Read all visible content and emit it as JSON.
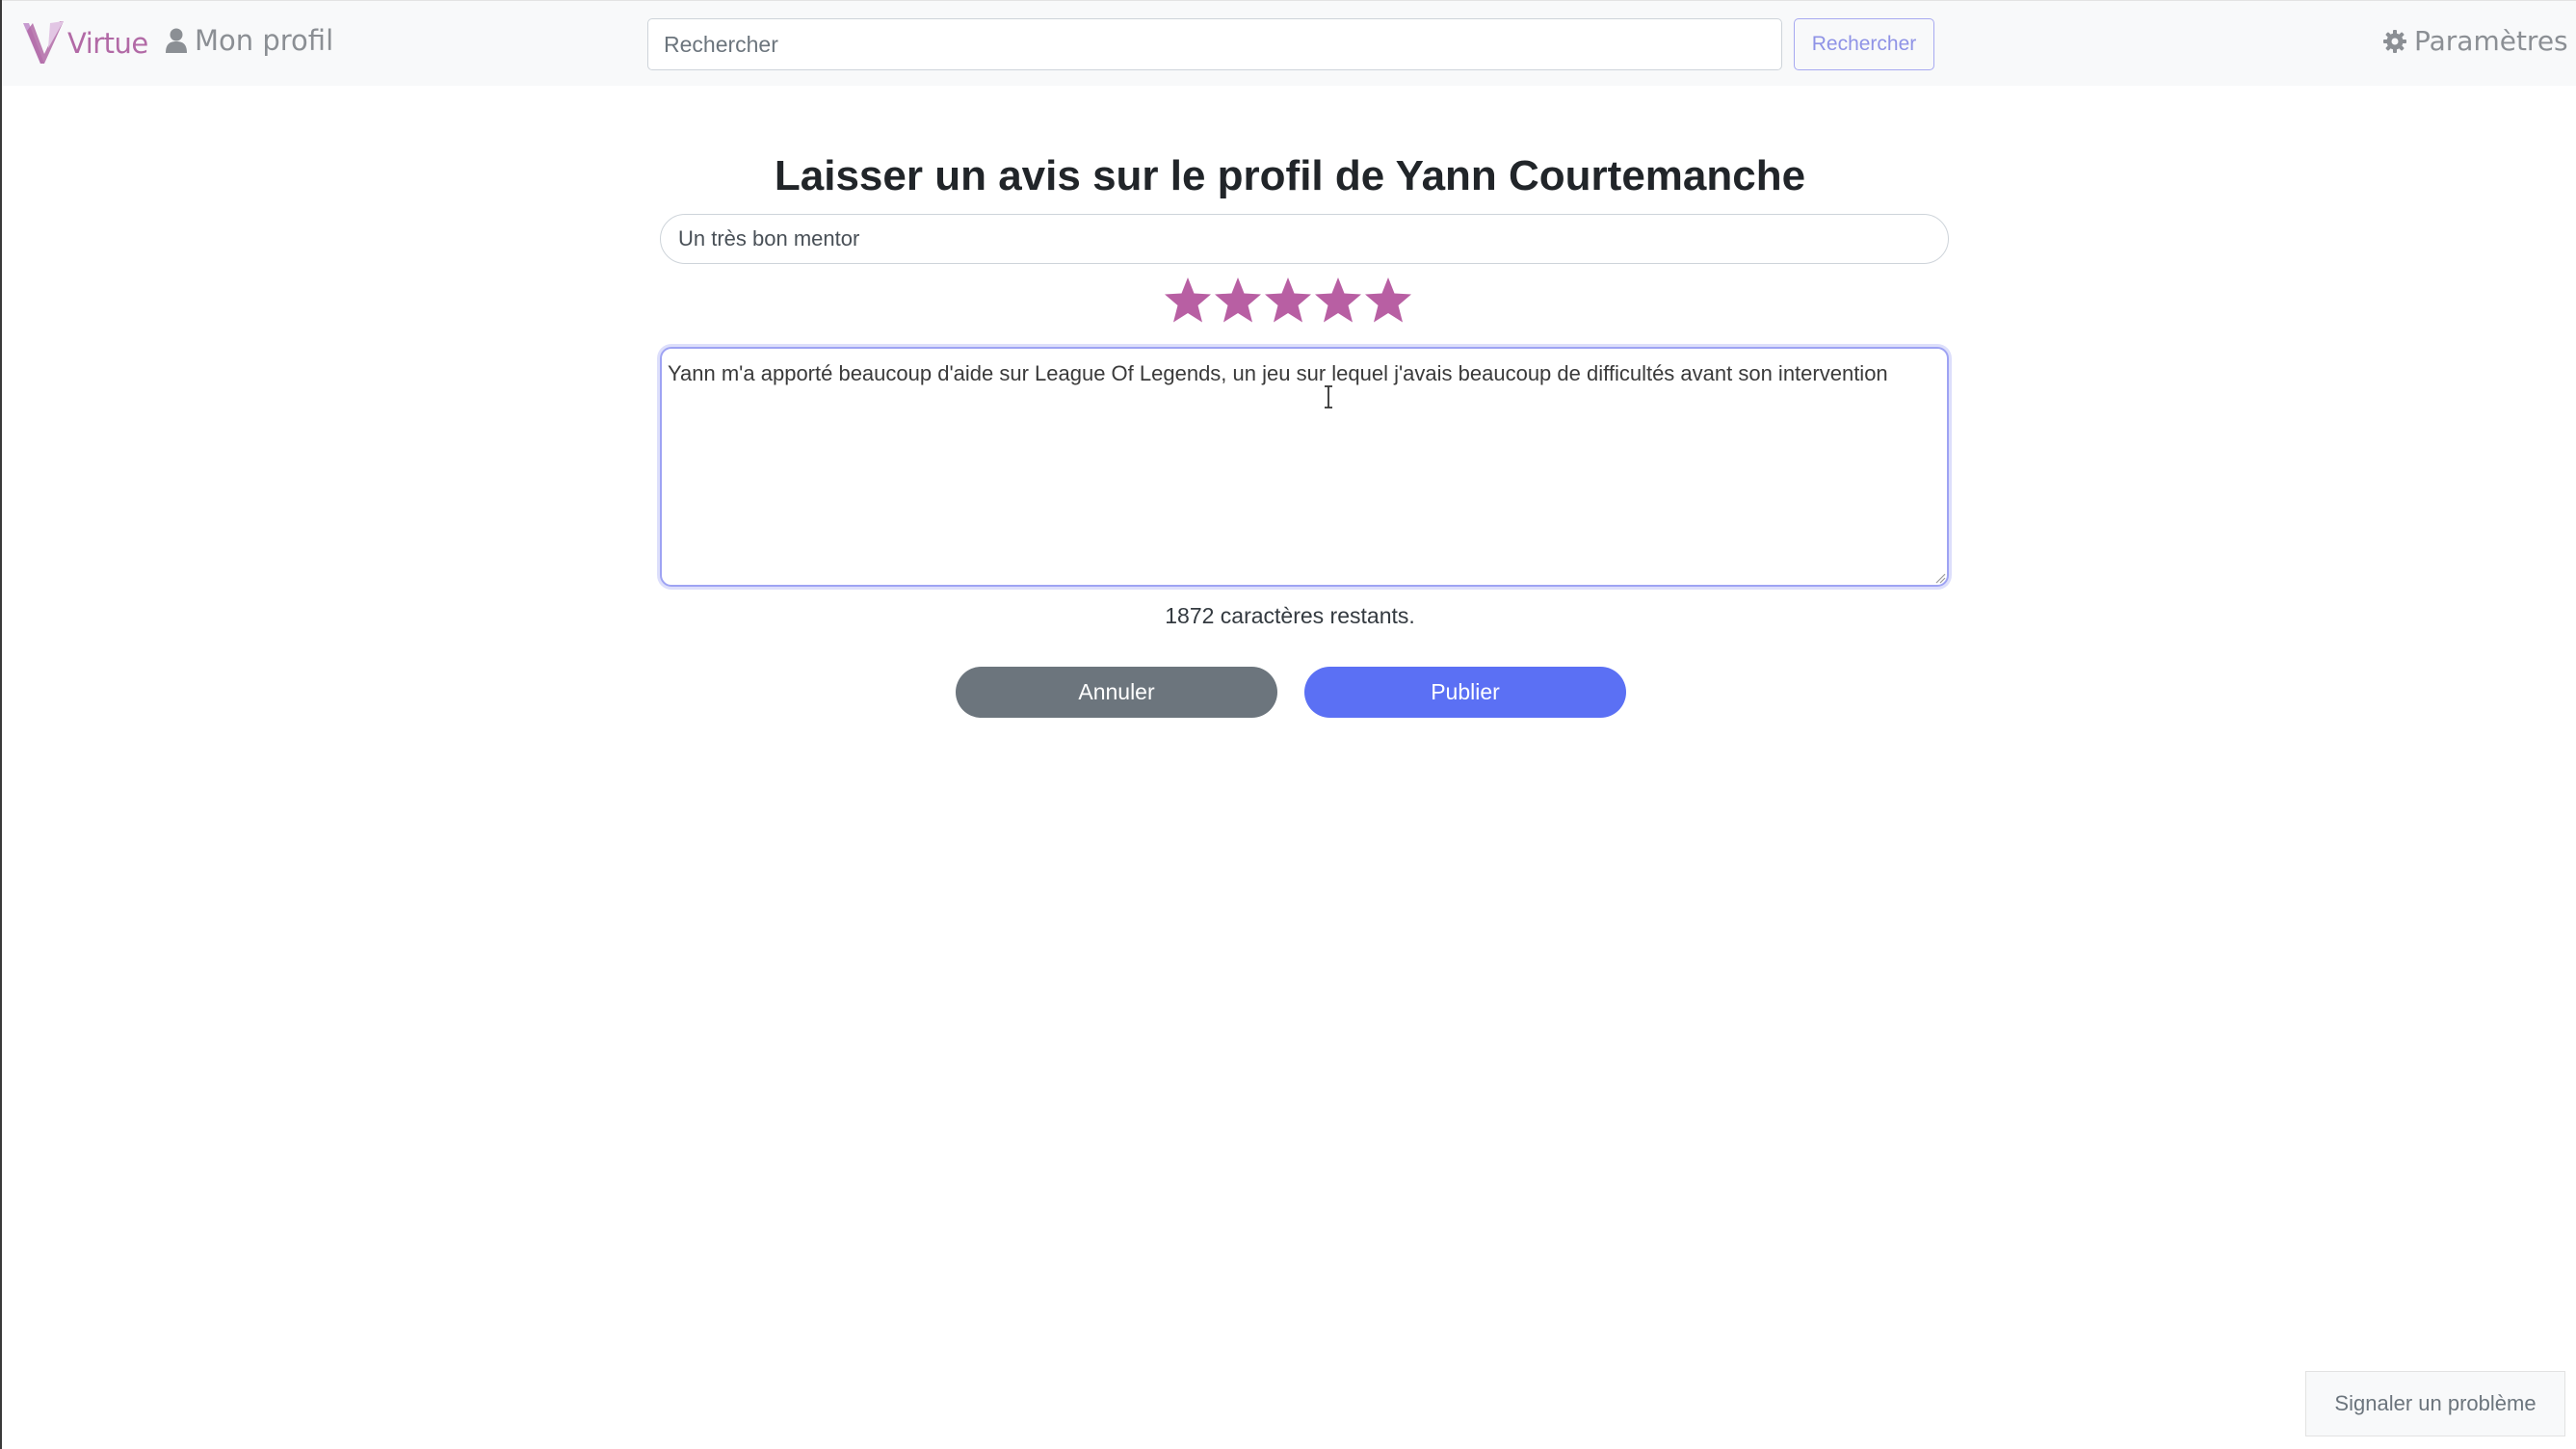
{
  "navbar": {
    "brand": "Virtue",
    "brand_icon": "virtue-v-logo",
    "profile_label": "Mon profil",
    "profile_icon": "user-icon",
    "search_placeholder": "Rechercher",
    "search_button": "Rechercher",
    "settings_label": "Paramètres",
    "settings_icon": "gear-icon"
  },
  "review": {
    "heading": "Laisser un avis sur le profil de Yann Courtemanche",
    "title_value": "Un très bon mentor",
    "rating": 5,
    "rating_max": 5,
    "body": "Yann m'a apporté beaucoup d'aide sur League Of Legends, un jeu sur lequel j'avais beaucoup de difficultés avant son intervention",
    "chars_remaining": "1872 caractères restants.",
    "cancel_label": "Annuler",
    "publish_label": "Publier"
  },
  "footer": {
    "report_label": "Signaler un problème"
  },
  "colors": {
    "brand": "#b26aa6",
    "star": "#b85fa3",
    "publish": "#5b70f4",
    "cancel": "#6c757d",
    "focus_border": "#9ea3f3"
  }
}
